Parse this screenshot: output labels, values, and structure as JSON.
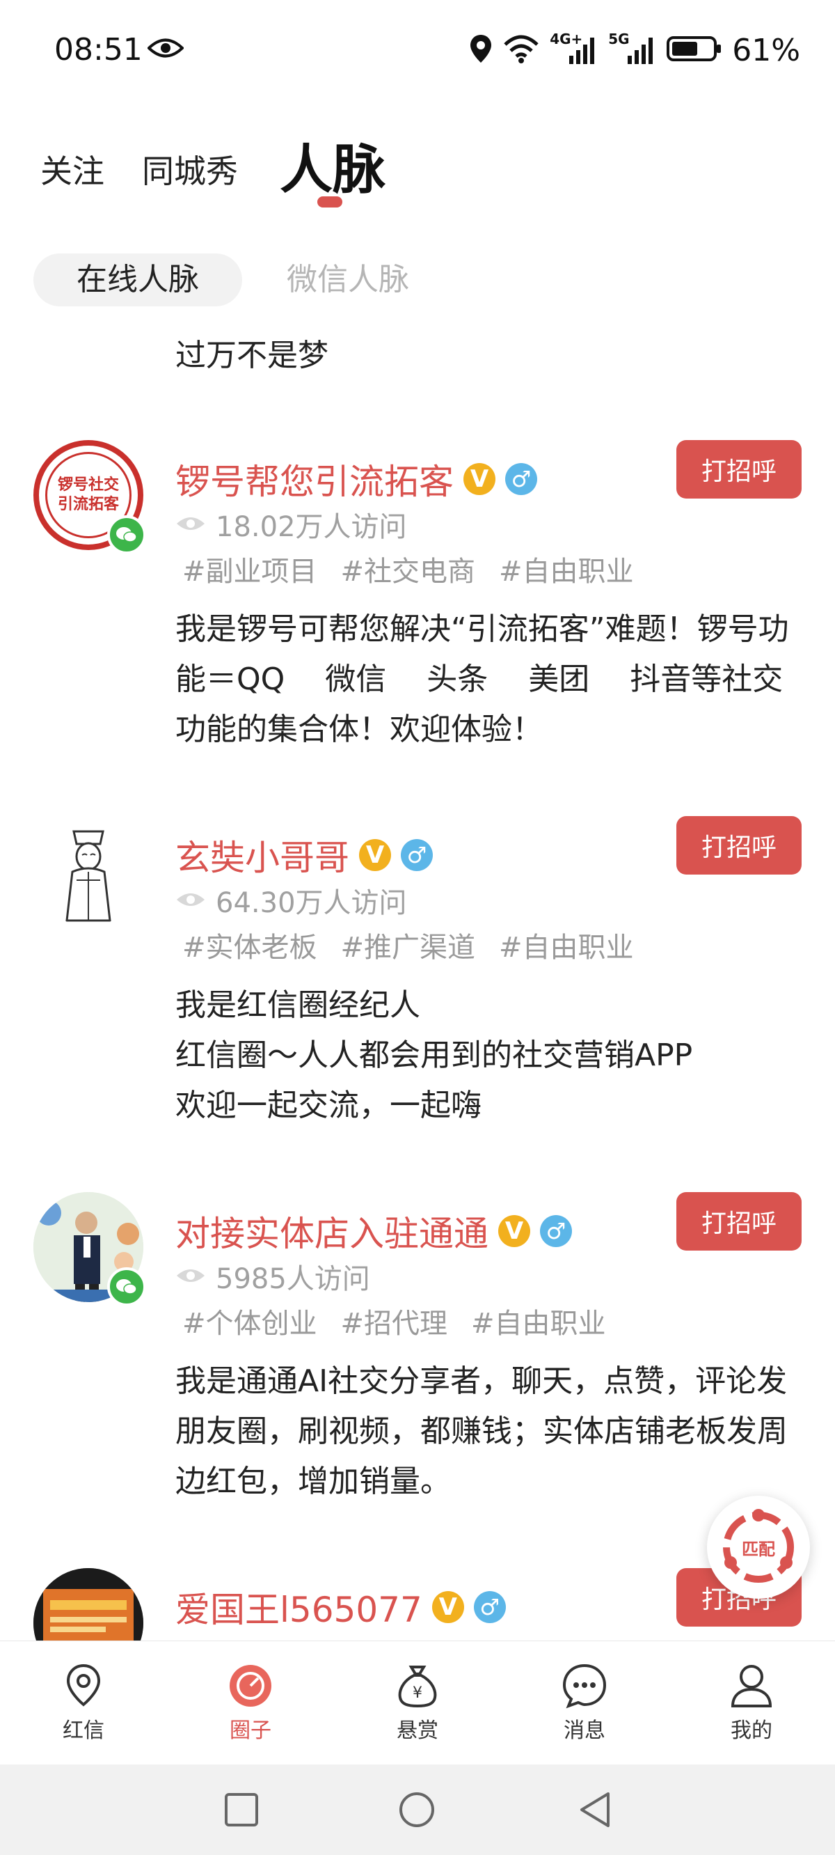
{
  "status_bar": {
    "time": "08:51",
    "network_4g": "4G+",
    "network_5g": "5G",
    "battery": "61%"
  },
  "top_tabs": [
    {
      "label": "关注",
      "active": false
    },
    {
      "label": "同城秀",
      "active": false
    },
    {
      "label": "人脉",
      "active": true
    }
  ],
  "sub_tabs": [
    {
      "label": "在线人脉",
      "active": true
    },
    {
      "label": "微信人脉",
      "active": false
    }
  ],
  "partial_desc": "过万不是梦",
  "cards": [
    {
      "avatar_text": "锣号社交\n引流拓客",
      "name": "锣号帮您引流拓客",
      "visits": "18.02万人访问",
      "tags": [
        "#副业项目",
        "#社交电商",
        "#自由职业"
      ],
      "description": "我是锣号可帮您解决“引流拓客”难题！锣号功能＝QQ　 微信　 头条　 美团　 抖音等社交功能的集合体！欢迎体验！",
      "greet_label": "打招呼",
      "wechat": true
    },
    {
      "name": "玄奘小哥哥",
      "visits": "64.30万人访问",
      "tags": [
        "#实体老板",
        "#推广渠道",
        "#自由职业"
      ],
      "description": "我是红信圈经纪人\n红信圈～人人都会用到的社交营销APP\n欢迎一起交流，一起嗨",
      "greet_label": "打招呼",
      "wechat": false
    },
    {
      "name": "对接实体店入驻通通",
      "visits": "5985人访问",
      "tags": [
        "#个体创业",
        "#招代理",
        "#自由职业"
      ],
      "description": "我是通通AI社交分享者，聊天，点赞，评论发朋友圈，刷视频，都赚钱；实体店铺老板发周边红包，增加销量。",
      "greet_label": "打招呼",
      "wechat": true
    },
    {
      "name": "爱国王l565077",
      "greet_label": "打招呼",
      "wechat": false
    }
  ],
  "vip_badge": "V",
  "male_badge": "♂",
  "match_label": "匹配",
  "bottom_nav": [
    {
      "label": "红信",
      "icon": "location-pin-icon",
      "active": false
    },
    {
      "label": "圈子",
      "icon": "circle-compass-icon",
      "active": true
    },
    {
      "label": "悬赏",
      "icon": "money-bag-icon",
      "active": false
    },
    {
      "label": "消息",
      "icon": "chat-bubble-icon",
      "active": false
    },
    {
      "label": "我的",
      "icon": "person-icon",
      "active": false
    }
  ],
  "colors": {
    "accent": "#d9534f",
    "vip": "#f2b01e",
    "male": "#5cb6e8",
    "wechat": "#3db54a"
  }
}
